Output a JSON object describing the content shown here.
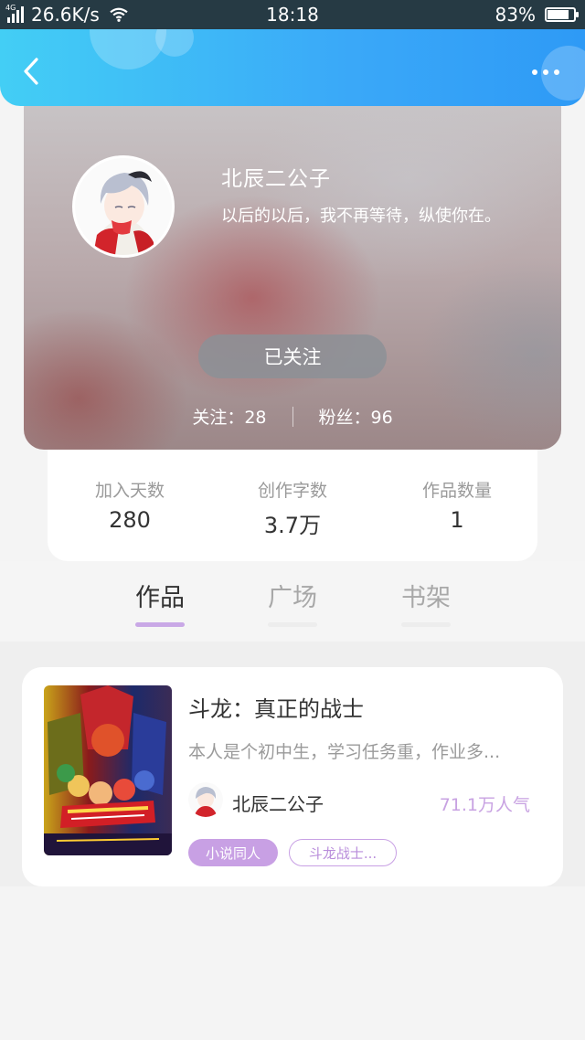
{
  "status_bar": {
    "network": "4G",
    "speed": "26.6K/s",
    "time": "18:18",
    "battery": "83%",
    "battery_level": 0.83
  },
  "nav": {
    "back_icon": "chevron-left-icon",
    "more_icon": "more-dots-icon"
  },
  "profile": {
    "name": "北辰二公子",
    "bio": "以后的以后，我不再等待，纵使你在。",
    "follow_button": "已关注",
    "following": "关注：28",
    "fans": "粉丝：96"
  },
  "stats": [
    {
      "label": "加入天数",
      "value": "280"
    },
    {
      "label": "创作字数",
      "value": "3.7万"
    },
    {
      "label": "作品数量",
      "value": "1"
    }
  ],
  "tabs": [
    {
      "label": "作品",
      "active": true
    },
    {
      "label": "广场",
      "active": false
    },
    {
      "label": "书架",
      "active": false
    }
  ],
  "works": [
    {
      "title": "斗龙：真正的战士",
      "description": "本人是个初中生，学习任务重，作业多...",
      "author": "北辰二公子",
      "popularity": "71.1万人气",
      "tags": [
        "小说同人",
        "斗龙战士..."
      ]
    }
  ],
  "colors": {
    "nav_gradient_start": "#43cef5",
    "nav_gradient_end": "#2e9af6",
    "accent_purple": "#c8a0e4",
    "status_bar": "#263a44"
  }
}
